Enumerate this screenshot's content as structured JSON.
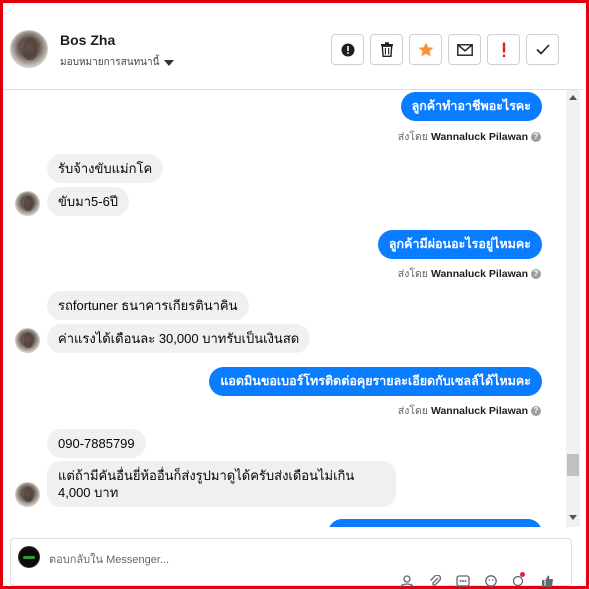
{
  "header": {
    "contact_name": "Bos Zha",
    "assign_label": "มอบหมายการสนทนานี้",
    "actions": [
      {
        "name": "block-button",
        "icon": "alert-circle-icon"
      },
      {
        "name": "delete-button",
        "icon": "trash-icon"
      },
      {
        "name": "star-button",
        "icon": "star-icon"
      },
      {
        "name": "unread-button",
        "icon": "envelope-icon"
      },
      {
        "name": "spam-button",
        "icon": "exclamation-icon"
      },
      {
        "name": "done-button",
        "icon": "checkmark-icon"
      }
    ]
  },
  "messages": [
    {
      "dir": "out",
      "text": "ลูกค้าทำอาชีพอะไรคะ"
    },
    {
      "dir": "sent_by",
      "prefix": "ส่งโดย",
      "agent": "Wannaluck Pilawan"
    },
    {
      "dir": "in",
      "text": "รับจ้างขับแม่กโค"
    },
    {
      "dir": "in",
      "text": "ขับมา5-6ปี"
    },
    {
      "dir": "out",
      "text": "ลูกค้ามีผ่อนอะไรอยู่ไหมคะ"
    },
    {
      "dir": "sent_by",
      "prefix": "ส่งโดย",
      "agent": "Wannaluck Pilawan"
    },
    {
      "dir": "in",
      "text": "รถfortuner ธนาคารเกียรตินาคิน"
    },
    {
      "dir": "in",
      "text": "ค่าแรงได้เดือนละ 30,000 บาทรับเป็นเงินสด"
    },
    {
      "dir": "out",
      "text": "แอดมินขอเบอร์โทรติดต่อคุยรายละเอียดกับเซลล์ได้ไหมคะ"
    },
    {
      "dir": "sent_by",
      "prefix": "ส่งโดย",
      "agent": "Wannaluck Pilawan"
    },
    {
      "dir": "in",
      "text": "090-7885799"
    },
    {
      "dir": "in",
      "text": "แต่ถ้ามีคันอื่นยี่ห้ออื่นก็ส่งรูปมาดูได้ครับส่งเดือนไม่เกิน 4,000 บาท"
    }
  ],
  "composer": {
    "placeholder": "ตอบกลับใน Messenger..."
  },
  "colors": {
    "outgoing_bubble": "#0a7cff",
    "incoming_bubble": "#f0f0f0",
    "frame_border": "#e3000b",
    "star": "#f7923a",
    "spam_exclamation": "#e02020"
  }
}
